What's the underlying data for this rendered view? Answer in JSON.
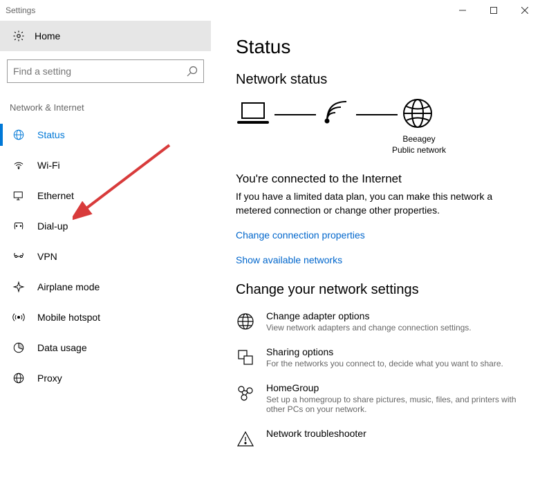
{
  "window_title": "Settings",
  "home_label": "Home",
  "search_placeholder": "Find a setting",
  "category_label": "Network & Internet",
  "nav": [
    {
      "label": "Status"
    },
    {
      "label": "Wi-Fi"
    },
    {
      "label": "Ethernet"
    },
    {
      "label": "Dial-up"
    },
    {
      "label": "VPN"
    },
    {
      "label": "Airplane mode"
    },
    {
      "label": "Mobile hotspot"
    },
    {
      "label": "Data usage"
    },
    {
      "label": "Proxy"
    }
  ],
  "page_title": "Status",
  "network_status_head": "Network status",
  "diagram_ssid": "Beeagey",
  "diagram_net_type": "Public network",
  "connected_head": "You're connected to the Internet",
  "connected_desc": "If you have a limited data plan, you can make this network a metered connection or change other properties.",
  "link_change_conn": "Change connection properties",
  "link_show_nets": "Show available networks",
  "change_settings_head": "Change your network settings",
  "opts": [
    {
      "title": "Change adapter options",
      "desc": "View network adapters and change connection settings."
    },
    {
      "title": "Sharing options",
      "desc": "For the networks you connect to, decide what you want to share."
    },
    {
      "title": "HomeGroup",
      "desc": "Set up a homegroup to share pictures, music, files, and printers with other PCs on your network."
    },
    {
      "title": "Network troubleshooter",
      "desc": ""
    }
  ]
}
